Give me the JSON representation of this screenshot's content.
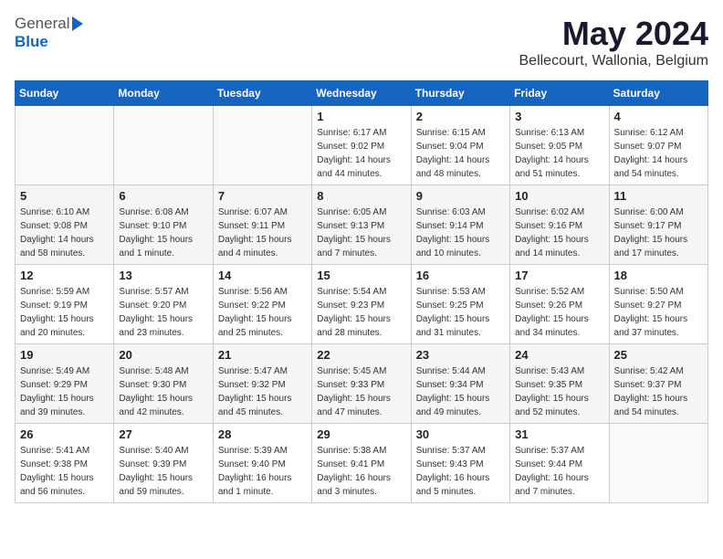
{
  "header": {
    "logo_general": "General",
    "logo_blue": "Blue",
    "title": "May 2024",
    "subtitle": "Bellecourt, Wallonia, Belgium"
  },
  "calendar": {
    "days_of_week": [
      "Sunday",
      "Monday",
      "Tuesday",
      "Wednesday",
      "Thursday",
      "Friday",
      "Saturday"
    ],
    "weeks": [
      [
        {
          "day": "",
          "info": ""
        },
        {
          "day": "",
          "info": ""
        },
        {
          "day": "",
          "info": ""
        },
        {
          "day": "1",
          "info": "Sunrise: 6:17 AM\nSunset: 9:02 PM\nDaylight: 14 hours\nand 44 minutes."
        },
        {
          "day": "2",
          "info": "Sunrise: 6:15 AM\nSunset: 9:04 PM\nDaylight: 14 hours\nand 48 minutes."
        },
        {
          "day": "3",
          "info": "Sunrise: 6:13 AM\nSunset: 9:05 PM\nDaylight: 14 hours\nand 51 minutes."
        },
        {
          "day": "4",
          "info": "Sunrise: 6:12 AM\nSunset: 9:07 PM\nDaylight: 14 hours\nand 54 minutes."
        }
      ],
      [
        {
          "day": "5",
          "info": "Sunrise: 6:10 AM\nSunset: 9:08 PM\nDaylight: 14 hours\nand 58 minutes."
        },
        {
          "day": "6",
          "info": "Sunrise: 6:08 AM\nSunset: 9:10 PM\nDaylight: 15 hours\nand 1 minute."
        },
        {
          "day": "7",
          "info": "Sunrise: 6:07 AM\nSunset: 9:11 PM\nDaylight: 15 hours\nand 4 minutes."
        },
        {
          "day": "8",
          "info": "Sunrise: 6:05 AM\nSunset: 9:13 PM\nDaylight: 15 hours\nand 7 minutes."
        },
        {
          "day": "9",
          "info": "Sunrise: 6:03 AM\nSunset: 9:14 PM\nDaylight: 15 hours\nand 10 minutes."
        },
        {
          "day": "10",
          "info": "Sunrise: 6:02 AM\nSunset: 9:16 PM\nDaylight: 15 hours\nand 14 minutes."
        },
        {
          "day": "11",
          "info": "Sunrise: 6:00 AM\nSunset: 9:17 PM\nDaylight: 15 hours\nand 17 minutes."
        }
      ],
      [
        {
          "day": "12",
          "info": "Sunrise: 5:59 AM\nSunset: 9:19 PM\nDaylight: 15 hours\nand 20 minutes."
        },
        {
          "day": "13",
          "info": "Sunrise: 5:57 AM\nSunset: 9:20 PM\nDaylight: 15 hours\nand 23 minutes."
        },
        {
          "day": "14",
          "info": "Sunrise: 5:56 AM\nSunset: 9:22 PM\nDaylight: 15 hours\nand 25 minutes."
        },
        {
          "day": "15",
          "info": "Sunrise: 5:54 AM\nSunset: 9:23 PM\nDaylight: 15 hours\nand 28 minutes."
        },
        {
          "day": "16",
          "info": "Sunrise: 5:53 AM\nSunset: 9:25 PM\nDaylight: 15 hours\nand 31 minutes."
        },
        {
          "day": "17",
          "info": "Sunrise: 5:52 AM\nSunset: 9:26 PM\nDaylight: 15 hours\nand 34 minutes."
        },
        {
          "day": "18",
          "info": "Sunrise: 5:50 AM\nSunset: 9:27 PM\nDaylight: 15 hours\nand 37 minutes."
        }
      ],
      [
        {
          "day": "19",
          "info": "Sunrise: 5:49 AM\nSunset: 9:29 PM\nDaylight: 15 hours\nand 39 minutes."
        },
        {
          "day": "20",
          "info": "Sunrise: 5:48 AM\nSunset: 9:30 PM\nDaylight: 15 hours\nand 42 minutes."
        },
        {
          "day": "21",
          "info": "Sunrise: 5:47 AM\nSunset: 9:32 PM\nDaylight: 15 hours\nand 45 minutes."
        },
        {
          "day": "22",
          "info": "Sunrise: 5:45 AM\nSunset: 9:33 PM\nDaylight: 15 hours\nand 47 minutes."
        },
        {
          "day": "23",
          "info": "Sunrise: 5:44 AM\nSunset: 9:34 PM\nDaylight: 15 hours\nand 49 minutes."
        },
        {
          "day": "24",
          "info": "Sunrise: 5:43 AM\nSunset: 9:35 PM\nDaylight: 15 hours\nand 52 minutes."
        },
        {
          "day": "25",
          "info": "Sunrise: 5:42 AM\nSunset: 9:37 PM\nDaylight: 15 hours\nand 54 minutes."
        }
      ],
      [
        {
          "day": "26",
          "info": "Sunrise: 5:41 AM\nSunset: 9:38 PM\nDaylight: 15 hours\nand 56 minutes."
        },
        {
          "day": "27",
          "info": "Sunrise: 5:40 AM\nSunset: 9:39 PM\nDaylight: 15 hours\nand 59 minutes."
        },
        {
          "day": "28",
          "info": "Sunrise: 5:39 AM\nSunset: 9:40 PM\nDaylight: 16 hours\nand 1 minute."
        },
        {
          "day": "29",
          "info": "Sunrise: 5:38 AM\nSunset: 9:41 PM\nDaylight: 16 hours\nand 3 minutes."
        },
        {
          "day": "30",
          "info": "Sunrise: 5:37 AM\nSunset: 9:43 PM\nDaylight: 16 hours\nand 5 minutes."
        },
        {
          "day": "31",
          "info": "Sunrise: 5:37 AM\nSunset: 9:44 PM\nDaylight: 16 hours\nand 7 minutes."
        },
        {
          "day": "",
          "info": ""
        }
      ]
    ]
  }
}
